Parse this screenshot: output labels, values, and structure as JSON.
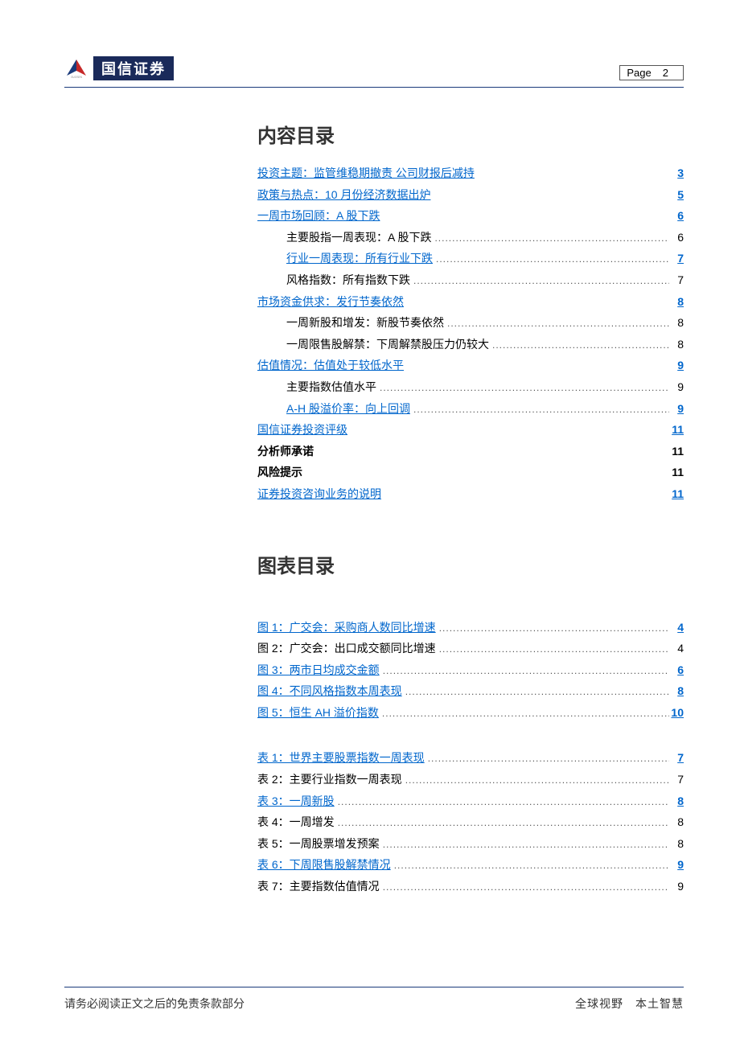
{
  "header": {
    "company_name": "国信证券",
    "page_label": "Page",
    "page_number": "2"
  },
  "toc_heading": "内容目录",
  "toc": [
    {
      "label": "投资主题：监管维稳期撤责 公司财报后减持",
      "page": "3",
      "link": true,
      "indent": 0,
      "dots": false
    },
    {
      "label": "政策与热点：10 月份经济数据出炉",
      "page": "5",
      "link": true,
      "indent": 0,
      "dots": false
    },
    {
      "label": "一周市场回顾：A 股下跌",
      "page": "6",
      "link": true,
      "indent": 0,
      "dots": false
    },
    {
      "label": "主要股指一周表现：A 股下跌",
      "page": "6",
      "link": false,
      "indent": 1,
      "dots": true
    },
    {
      "label": "行业一周表现：所有行业下跌",
      "page": "7",
      "link": true,
      "indent": 1,
      "dots": true
    },
    {
      "label": "风格指数：所有指数下跌",
      "page": "7",
      "link": false,
      "indent": 1,
      "dots": true
    },
    {
      "label": "市场资金供求：发行节奏依然",
      "page": "8",
      "link": true,
      "indent": 0,
      "dots": false
    },
    {
      "label": "一周新股和增发：新股节奏依然",
      "page": "8",
      "link": false,
      "indent": 1,
      "dots": true
    },
    {
      "label": "一周限售股解禁：下周解禁股压力仍较大",
      "page": "8",
      "link": false,
      "indent": 1,
      "dots": true
    },
    {
      "label": "估值情况：估值处于较低水平",
      "page": "9",
      "link": true,
      "indent": 0,
      "dots": false
    },
    {
      "label": "主要指数估值水平",
      "page": "9",
      "link": false,
      "indent": 1,
      "dots": true
    },
    {
      "label": "A-H 股溢价率：向上回调",
      "page": "9",
      "link": true,
      "indent": 1,
      "dots": true
    },
    {
      "label": "国信证券投资评级",
      "page": "11",
      "link": true,
      "indent": 0,
      "dots": false
    },
    {
      "label": "分析师承诺",
      "page": "11",
      "link": false,
      "bold": true,
      "indent": 0,
      "dots": false
    },
    {
      "label": "风险提示",
      "page": "11",
      "link": false,
      "bold": true,
      "indent": 0,
      "dots": false
    },
    {
      "label": "证券投资咨询业务的说明",
      "page": "11",
      "link": true,
      "indent": 0,
      "dots": false
    }
  ],
  "fig_heading": "图表目录",
  "figures": [
    {
      "label": "图 1：广交会：采购商人数同比增速",
      "page": "4",
      "link": true
    },
    {
      "label": "图 2：广交会：出口成交额同比增速",
      "page": "4",
      "link": false
    },
    {
      "label": "图 3：两市日均成交金额",
      "page": "6",
      "link": true
    },
    {
      "label": "图 4：不同风格指数本周表现",
      "page": "8",
      "link": true
    },
    {
      "label": "图 5：恒生 AH 溢价指数",
      "page": "10",
      "link": true
    }
  ],
  "tables": [
    {
      "label": "表 1：世界主要股票指数一周表现",
      "page": "7",
      "link": true
    },
    {
      "label": "表 2：主要行业指数一周表现",
      "page": "7",
      "link": false
    },
    {
      "label": "表 3：一周新股",
      "page": "8",
      "link": true
    },
    {
      "label": "表 4：一周增发",
      "page": "8",
      "link": false
    },
    {
      "label": "表 5：一周股票增发预案",
      "page": "8",
      "link": false
    },
    {
      "label": "表 6：下周限售股解禁情况",
      "page": "9",
      "link": true
    },
    {
      "label": "表 7：主要指数估值情况",
      "page": "9",
      "link": false
    }
  ],
  "footer": {
    "left": "请务必阅读正文之后的免责条款部分",
    "right": "全球视野　本土智慧"
  }
}
